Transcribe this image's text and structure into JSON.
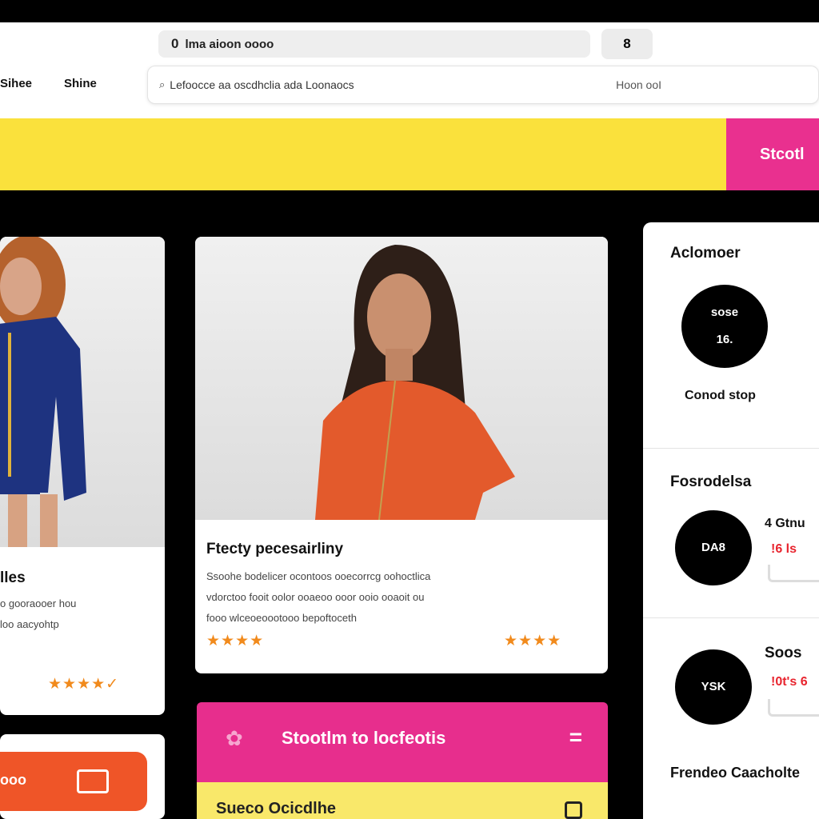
{
  "browser": {
    "url_text": "lma aioon oooo",
    "url_glyph": "0",
    "tab_label": "8"
  },
  "nav": {
    "link_1": "Sihee",
    "link_2": "Shine"
  },
  "search": {
    "text": "Lefoocce aa oscdhclia ada Loonaocs",
    "right_text": "Hoon ooI"
  },
  "banner": {
    "button_label": "Stcotl"
  },
  "cards": [
    {
      "title": "lles",
      "desc_lines": [
        "o gooraooer hou",
        "loo aacyohtp"
      ],
      "stars": "★★★★✓"
    },
    {
      "title": "Ftecty pecesairliny",
      "desc_lines": [
        "Ssoohe bodelicer ocontoos ooecorrcg oohoctlica",
        "vdorctoo fooit oolor ooaeoo ooor ooio ooaoit ou",
        "fooo wlceoeoootooo bepoftoceth"
      ],
      "stars_left": "★★★★",
      "stars_right": "★★★★"
    }
  ],
  "promo": {
    "label": "Stootlm to locfeotis",
    "menu_icon": "=",
    "sub_label": "Sueco Ocicdlhe"
  },
  "cta": {
    "label": "ooo"
  },
  "sidebar": {
    "section1": {
      "title": "Aclomoer",
      "circle_lines": [
        "sose",
        "16."
      ],
      "caption": "Conod stop"
    },
    "section2": {
      "title": "Fosrodelsa",
      "circle_text": "DA8",
      "line1": "4 Gtnu",
      "price": "!6 ls"
    },
    "section3": {
      "title": "Soos",
      "circle_text": "YSK",
      "price": "!0t's 6"
    },
    "footer": "Frendeo Caacholte"
  },
  "colors": {
    "banner_yellow": "#fae13c",
    "accent_pink": "#e9308f",
    "cta_orange": "#ef5528",
    "star_orange": "#f18a1c"
  }
}
